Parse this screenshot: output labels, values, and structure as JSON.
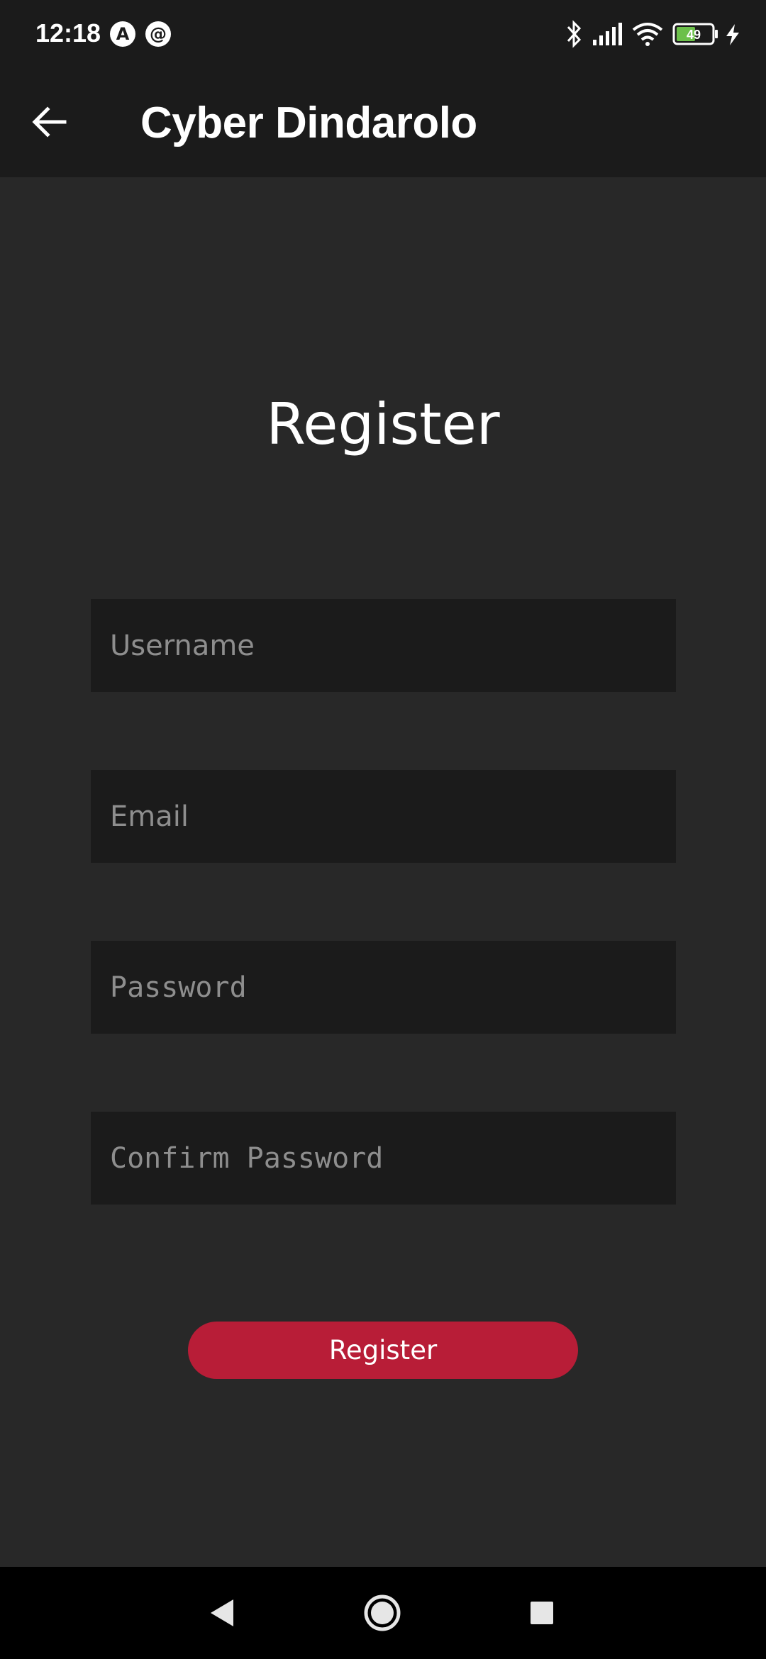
{
  "status_bar": {
    "time": "12:18",
    "app_icons": [
      "A",
      "@"
    ],
    "battery": "49",
    "icons": [
      "bluetooth-icon",
      "signal-icon",
      "wifi-icon",
      "battery-icon",
      "charging-icon"
    ]
  },
  "app_bar": {
    "title": "Cyber Dindarolo",
    "back_icon": "arrow-left-icon"
  },
  "page": {
    "title": "Register",
    "fields": {
      "username": {
        "placeholder": "Username",
        "value": ""
      },
      "email": {
        "placeholder": "Email",
        "value": ""
      },
      "password": {
        "placeholder": "Password",
        "value": ""
      },
      "confirm_password": {
        "placeholder": "Confirm Password",
        "value": ""
      }
    },
    "register_button": "Register"
  },
  "nav_bar": {
    "icons": [
      "back-triangle-icon",
      "home-circle-icon",
      "recents-square-icon"
    ]
  },
  "colors": {
    "background": "#282828",
    "bar": "#1b1b1b",
    "field": "#1b1b1b",
    "accent": "#b81d37",
    "placeholder": "#8e8e8e"
  }
}
